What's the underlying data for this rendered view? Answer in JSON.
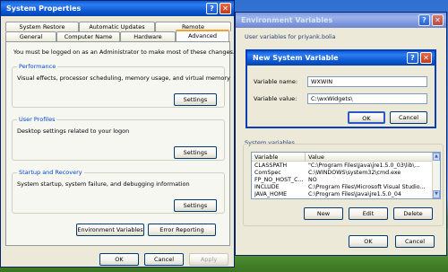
{
  "system_properties": {
    "title": "System Properties",
    "tabs_row1": [
      "System Restore",
      "Automatic Updates",
      "Remote"
    ],
    "tabs_row2": [
      "General",
      "Computer Name",
      "Hardware",
      "Advanced"
    ],
    "admin_note": "You must be logged on as an Administrator to make most of these changes.",
    "performance": {
      "label": "Performance",
      "desc": "Visual effects, processor scheduling, memory usage, and virtual memory",
      "button": "Settings"
    },
    "user_profiles": {
      "label": "User Profiles",
      "desc": "Desktop settings related to your logon",
      "button": "Settings"
    },
    "startup": {
      "label": "Startup and Recovery",
      "desc": "System startup, system failure, and debugging information",
      "button": "Settings"
    },
    "env_button": "Environment Variables",
    "error_button": "Error Reporting",
    "ok": "OK",
    "cancel": "Cancel",
    "apply": "Apply"
  },
  "env_vars": {
    "title": "Environment Variables",
    "user_vars_label": "User variables for priyank.bolia",
    "system_vars_label": "System variables",
    "columns": [
      "Variable",
      "Value"
    ],
    "rows": [
      {
        "variable": "CLASSPATH",
        "value": "\"C:\\Program Files\\Java\\jre1.5.0_03\\lib\\..."
      },
      {
        "variable": "ComSpec",
        "value": "C:\\WINDOWS\\system32\\cmd.exe"
      },
      {
        "variable": "FP_NO_HOST_C...",
        "value": "NO"
      },
      {
        "variable": "INCLUDE",
        "value": "C:\\Program Files\\Microsoft Visual Studio..."
      },
      {
        "variable": "JAVA_HOME",
        "value": "C:\\Program Files\\Java\\jre1.5.0_04"
      }
    ],
    "new": "New",
    "edit": "Edit",
    "delete": "Delete",
    "ok": "OK",
    "cancel": "Cancel"
  },
  "new_var_dialog": {
    "title": "New System Variable",
    "name_label": "Variable name:",
    "name_value": "WXWIN",
    "value_label": "Variable value:",
    "value_value": "C:\\wxWidgets\\",
    "ok": "OK",
    "cancel": "Cancel"
  }
}
